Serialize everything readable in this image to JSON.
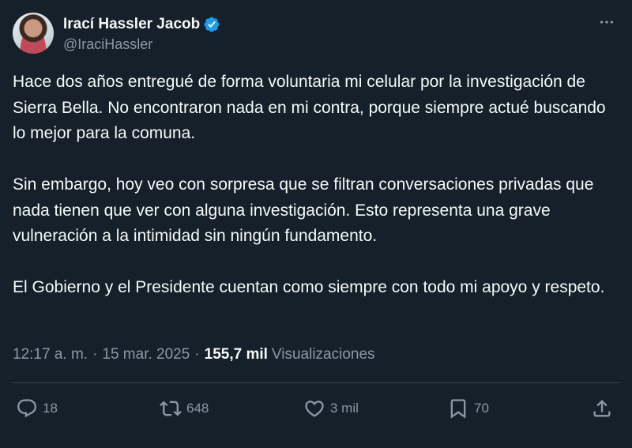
{
  "author": {
    "display_name": "Irací Hassler Jacob",
    "handle": "@IraciHassler",
    "verified_icon": "verified-badge-icon",
    "avatar_icon": "avatar"
  },
  "more_icon": "more-options-icon",
  "tweet": {
    "paragraphs": [
      "Hace dos años entregué de forma voluntaria mi celular por la investigación de Sierra Bella. No encontraron nada en mi contra, porque siempre actué buscando lo mejor para la comuna.",
      "Sin embargo, hoy veo con sorpresa que se filtran conversaciones privadas que nada tienen que ver con alguna investigación. Esto representa una grave vulneración a la intimidad sin ningún fundamento.",
      "El Gobierno y el Presidente cuentan como siempre con todo mi apoyo y respeto."
    ]
  },
  "meta": {
    "time": "12:17 a. m.",
    "separator": "·",
    "date": "15 mar. 2025",
    "views_count": "155,7 mil",
    "views_label": "Visualizaciones"
  },
  "actions": {
    "reply": {
      "icon": "reply-icon",
      "count": "18"
    },
    "retweet": {
      "icon": "retweet-icon",
      "count": "648"
    },
    "like": {
      "icon": "heart-icon",
      "count": "3 mil"
    },
    "bookmark": {
      "icon": "bookmark-icon",
      "count": "70"
    },
    "share": {
      "icon": "share-icon"
    }
  },
  "colors": {
    "background": "#15202b",
    "text": "#f7f9f9",
    "secondary": "#8b98a5",
    "verified": "#1d9bf0",
    "divider": "#38444d"
  }
}
